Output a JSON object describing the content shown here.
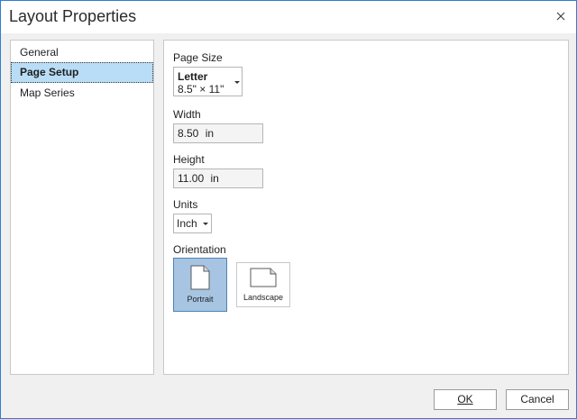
{
  "window": {
    "title": "Layout Properties",
    "close_icon": "close-icon"
  },
  "nav": {
    "items": [
      {
        "label": "General",
        "selected": false
      },
      {
        "label": "Page Setup",
        "selected": true
      },
      {
        "label": "Map Series",
        "selected": false
      }
    ]
  },
  "page_setup": {
    "page_size": {
      "label": "Page Size",
      "name": "Letter",
      "dimensions": "8.5\" × 11\""
    },
    "width": {
      "label": "Width",
      "value": "8.50",
      "unit": "in"
    },
    "height": {
      "label": "Height",
      "value": "11.00",
      "unit": "in"
    },
    "units": {
      "label": "Units",
      "value": "Inch"
    },
    "orientation": {
      "label": "Orientation",
      "options": [
        {
          "label": "Portrait",
          "selected": true
        },
        {
          "label": "Landscape",
          "selected": false
        }
      ]
    }
  },
  "buttons": {
    "ok": "OK",
    "cancel": "Cancel"
  },
  "colors": {
    "accent_border": "#2d7dd2",
    "selected_nav_bg": "#b9ddf7",
    "selected_orientation_bg": "#a7c5e2"
  }
}
